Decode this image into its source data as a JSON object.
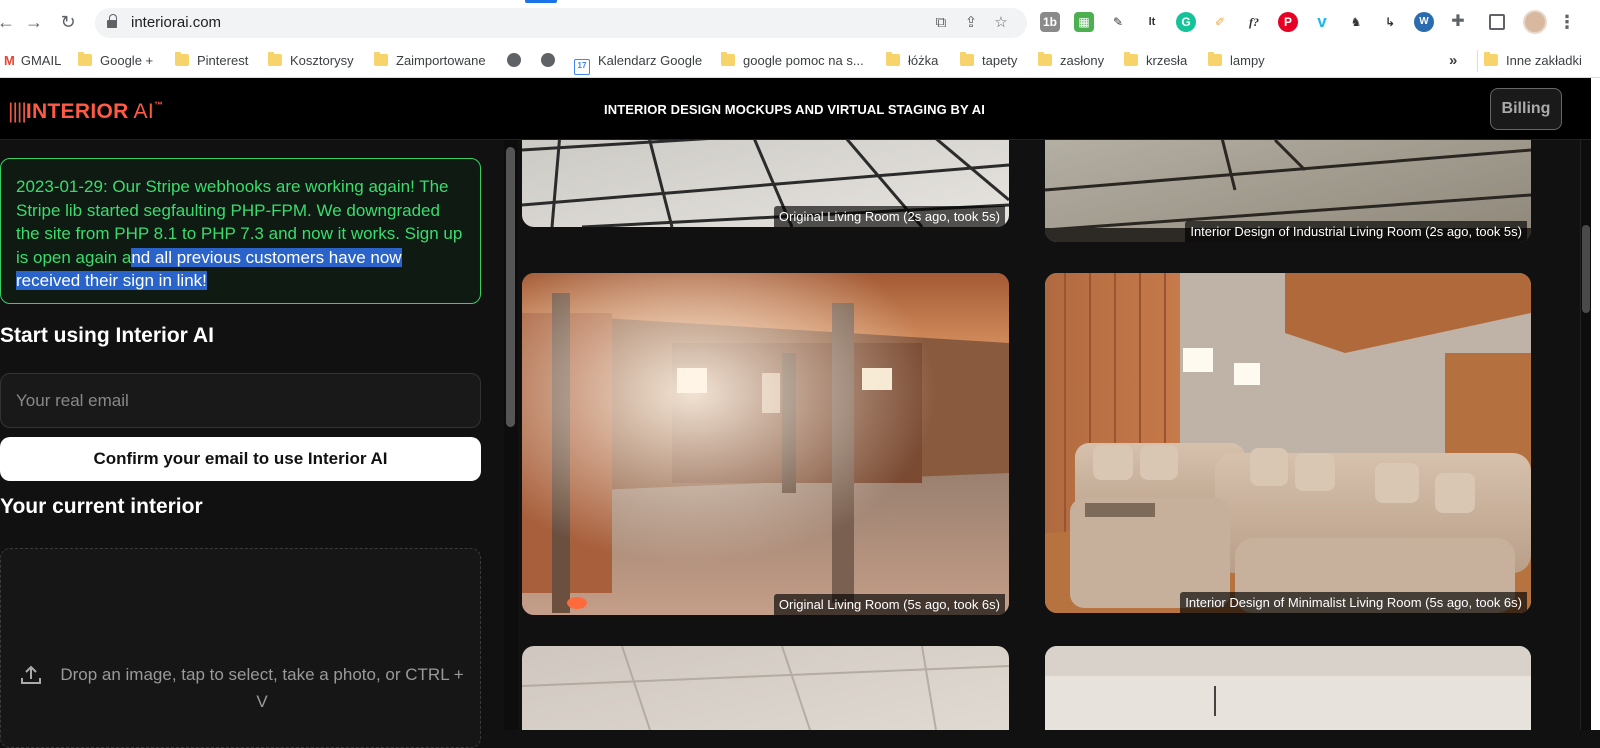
{
  "browser": {
    "url": "interiorai.com",
    "bookmarks": [
      "GMAIL",
      "Google +",
      "Pinterest",
      "Kosztorysy",
      "Zaimportowane",
      "Kalendarz Google",
      "google pomoc na s...",
      "łóżka",
      "tapety",
      "zasłony",
      "krzesła",
      "lampy"
    ],
    "calendar_day": "17",
    "more_bookmarks": "»",
    "other_bookmarks": "Inne zakładki",
    "extensions": [
      "ext-1b",
      "ext-green",
      "ext-pen",
      "ext-lt",
      "ext-grammarly",
      "ext-highlighter",
      "ext-formula",
      "pinterest",
      "vimeo",
      "ext-figure",
      "ext-arrow",
      "ext-wp",
      "puzzle",
      "sidepanel"
    ],
    "ext_labels": {
      "e1": "1b",
      "lt": "lt",
      "formula": "f?",
      "pinterest": "P",
      "vimeo": "v",
      "wp": "W"
    }
  },
  "header": {
    "logo_bars": "||||",
    "logo_main": "INTERIOR",
    "logo_ai": " AI",
    "logo_tm": "™",
    "title": "INTERIOR DESIGN MOCKUPS AND VIRTUAL STAGING BY AI",
    "billing_label": "Billing"
  },
  "left": {
    "notice_plain": "2023-01-29: Our Stripe webhooks are working again! The Stripe lib started segfaulting PHP-FPM. We downgraded the site from PHP 8.1 to PHP 7.3 and now it works. Sign up is open again a",
    "notice_selected": "nd all previous customers have now received their sign in link!",
    "start_heading": "Start using Interior AI",
    "email_placeholder": "Your real email",
    "confirm_label": "Confirm your email to use Interior AI",
    "current_heading": "Your current interior",
    "drop_text": "Drop an image, tap to select, take a photo, or CTRL + V"
  },
  "gallery": {
    "captions": [
      "Original Living Room (2s ago, took 5s)",
      "Interior Design of Industrial Living Room (2s ago, took 5s)",
      "Original Living Room (5s ago, took 6s)",
      "Interior Design of Minimalist Living Room (5s ago, took 6s)"
    ]
  },
  "colors": {
    "accent": "#ff5a45",
    "notice_text": "#3bdc6e",
    "notice_border": "#37d066",
    "selection": "#2a63c9",
    "background": "#111111"
  }
}
